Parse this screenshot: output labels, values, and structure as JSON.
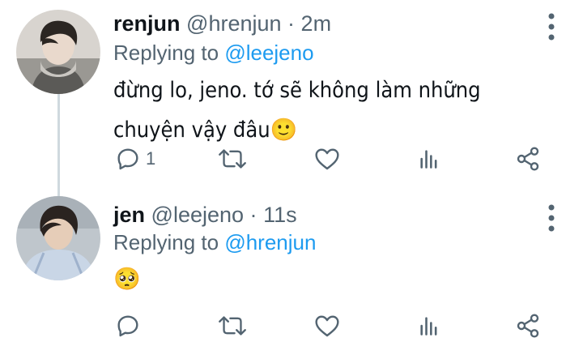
{
  "tweets": [
    {
      "name": "renjun",
      "handle": "@hrenjun",
      "separator": "·",
      "time": "2m",
      "replying_prefix": "Replying to",
      "replying_to": "@leejeno",
      "text": "đừng lo, jeno. tớ sẽ không làm những chuyện vậy đâu",
      "emoji": "🙂",
      "reply_count": "1",
      "avatar_icon": "avatar-photo-icon"
    },
    {
      "name": "jen",
      "handle": "@leejeno",
      "separator": "·",
      "time": "11s",
      "replying_prefix": "Replying to",
      "replying_to": "@hrenjun",
      "text": "",
      "emoji": "🥺",
      "reply_count": "",
      "avatar_icon": "avatar-photo-icon"
    }
  ],
  "colors": {
    "text": "#0f1419",
    "muted": "#536471",
    "link": "#1d9bf0",
    "thread_line": "#cfd9de"
  },
  "icons": [
    "reply-icon",
    "retweet-icon",
    "like-icon",
    "views-icon",
    "share-icon",
    "more-options-icon"
  ]
}
